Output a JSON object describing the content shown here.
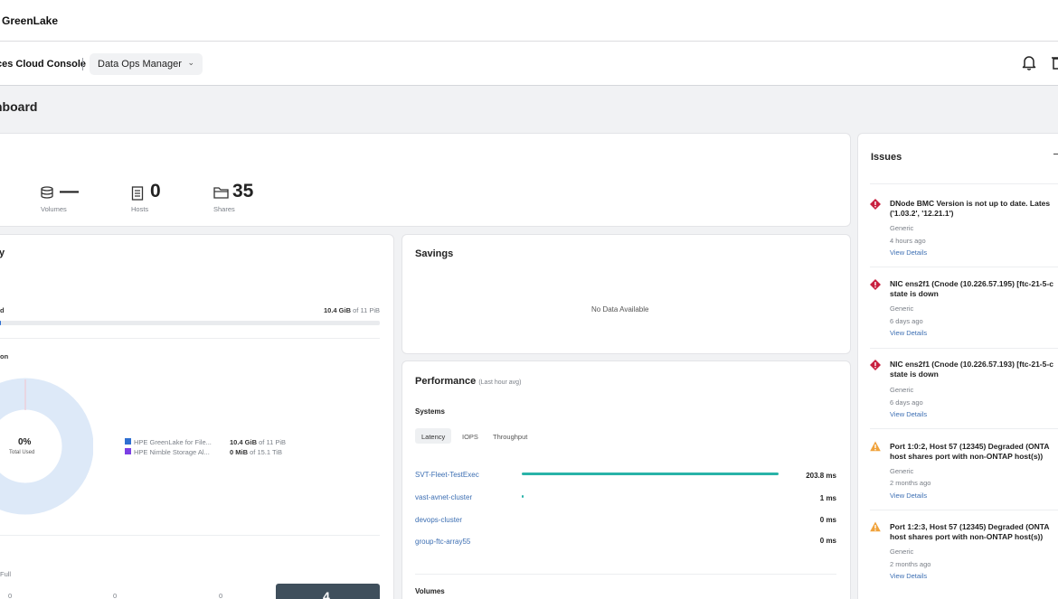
{
  "brand": {
    "name": "GreenLake"
  },
  "nav": {
    "console_title": "ces Cloud Console",
    "separator": "|",
    "context": "Data Ops Manager"
  },
  "page": {
    "title": "hboard"
  },
  "summary": {
    "volumes": {
      "value": "—",
      "label": "Volumes"
    },
    "hosts": {
      "value": "0",
      "label": "Hosts"
    },
    "shares": {
      "value": "35",
      "label": "Shares"
    }
  },
  "capacity": {
    "title_fragment": "y",
    "used_label": "d",
    "used_value": "10.4 GiB",
    "used_of": "of 11 PiB",
    "used_fraction": 9e-10,
    "distribution_label": "on",
    "donut_pct": "0%",
    "donut_label": "Total Used",
    "legend": [
      {
        "name": "HPE GreenLake for File...",
        "value": "10.4 GiB",
        "of": "of 11 PiB",
        "color": "#2f6fd1"
      },
      {
        "name": "HPE Nimble Storage Al...",
        "value": "0 MiB",
        "of": "of 15.1 TiB",
        "color": "#7b3fe4"
      }
    ],
    "full_label": "Full",
    "bottom_counts": [
      "0",
      "0",
      "0"
    ],
    "bottom_highlight": "4"
  },
  "savings": {
    "title": "Savings",
    "empty": "No Data Available"
  },
  "performance": {
    "title": "Performance",
    "subtitle": "(Last hour avg)",
    "systems_label": "Systems",
    "tabs": [
      "Latency",
      "IOPS",
      "Throughput"
    ],
    "active_tab": "Latency",
    "rows": [
      {
        "name": "SVT-Fleet-TestExec",
        "value": "203.8 ms",
        "ms": 203.8
      },
      {
        "name": "vast-avnet-cluster",
        "value": "1 ms",
        "ms": 1
      },
      {
        "name": "devops-cluster",
        "value": "0 ms",
        "ms": 0
      },
      {
        "name": "group-ftc-array55",
        "value": "0 ms",
        "ms": 0
      }
    ],
    "volumes_label": "Volumes"
  },
  "issues": {
    "title": "Issues",
    "items": [
      {
        "severity": "critical",
        "title1": "DNode BMC Version is not up to date. Lates",
        "title2": "('1.03.2', '12.21.1')",
        "category": "Generic",
        "time": "4 hours ago",
        "link": "View Details"
      },
      {
        "severity": "critical",
        "title1": "NIC ens2f1 (Cnode (10.226.57.195) [ftc-21-5-c",
        "title2": "state is down",
        "category": "Generic",
        "time": "6 days ago",
        "link": "View Details"
      },
      {
        "severity": "critical",
        "title1": "NIC ens2f1 (Cnode (10.226.57.193) [ftc-21-5-c",
        "title2": "state is down",
        "category": "Generic",
        "time": "6 days ago",
        "link": "View Details"
      },
      {
        "severity": "warning",
        "title1": "Port 1:0:2, Host 57 (12345) Degraded (ONTA",
        "title2": "host shares port with non-ONTAP host(s))",
        "category": "Generic",
        "time": "2 months ago",
        "link": "View Details"
      },
      {
        "severity": "warning",
        "title1": "Port 1:2:3, Host 57 (12345) Degraded (ONTA",
        "title2": "host shares port with non-ONTAP host(s))",
        "category": "Generic",
        "time": "2 months ago",
        "link": "View Details"
      }
    ]
  },
  "colors": {
    "accent": "#29b3a8",
    "critical": "#c8203f",
    "warning": "#f0a23b",
    "donut": "#dde9f8"
  }
}
